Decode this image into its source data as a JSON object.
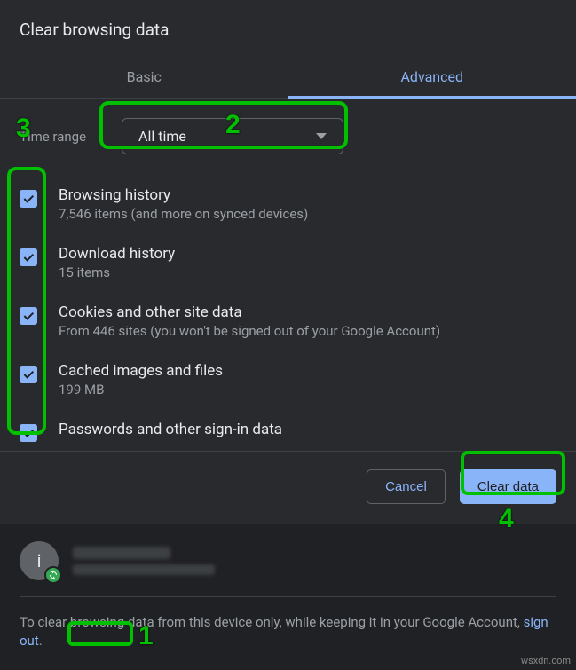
{
  "dialog": {
    "title": "Clear browsing data",
    "tabs": {
      "basic": "Basic",
      "advanced": "Advanced",
      "active": "advanced"
    },
    "time_range": {
      "label": "Time range",
      "selected": "All time"
    },
    "items": [
      {
        "title": "Browsing history",
        "sub": "7,546 items (and more on synced devices)",
        "checked": true
      },
      {
        "title": "Download history",
        "sub": "15 items",
        "checked": true
      },
      {
        "title": "Cookies and other site data",
        "sub": "From 446 sites (you won't be signed out of your Google Account)",
        "checked": true
      },
      {
        "title": "Cached images and files",
        "sub": "199 MB",
        "checked": true
      },
      {
        "title": "Passwords and other sign-in data",
        "sub": "",
        "checked": true
      }
    ],
    "actions": {
      "cancel": "Cancel",
      "clear": "Clear data"
    }
  },
  "account": {
    "avatar_letter": "i"
  },
  "footer": {
    "text_before": "To clear browsing data from this device only, while keeping it in your Google Account, ",
    "link": "sign out",
    "text_after": "."
  },
  "annotations": {
    "n1": "1",
    "n2": "2",
    "n3": "3",
    "n4": "4"
  },
  "watermark": "wsxdn.com"
}
